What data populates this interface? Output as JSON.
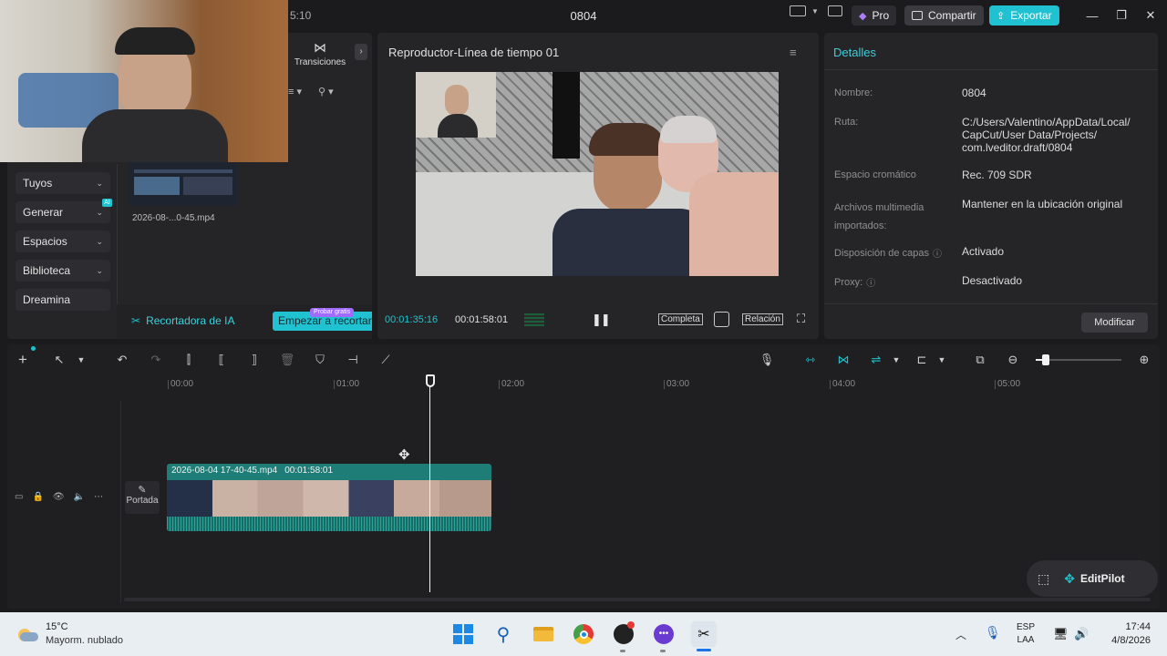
{
  "window": {
    "title": "0804",
    "clock_partial": "5:10",
    "pro_label": "Pro",
    "share_label": "Compartir",
    "export_label": "Exportar"
  },
  "media_panel": {
    "transitions_label": "Transiciones",
    "sidebar": [
      {
        "label": "Tuyos"
      },
      {
        "label": "Generar",
        "badge": "AI"
      },
      {
        "label": "Espacios"
      },
      {
        "label": "Biblioteca"
      },
      {
        "label": "Dreamina"
      }
    ],
    "clip_name": "2026-08-...0-45.mp4",
    "ai_cutter_label": "Recortadora de IA",
    "start_cut_label": "Empezar a recortar",
    "try_free_badge": "Probar gratis"
  },
  "player": {
    "title": "Reproductor-Línea de tiempo 01",
    "current_time": "00:01:35:16",
    "total_time": "00:01:58:01",
    "full_label": "Completa",
    "ratio_label": "Relación"
  },
  "details": {
    "title": "Detalles",
    "rows": [
      {
        "key": "Nombre:",
        "value": "0804"
      },
      {
        "key": "Ruta:",
        "value": "C:/Users/Valentino/AppData/Local/\nCapCut/User Data/Projects/\ncom.lveditor.draft/0804"
      },
      {
        "key": "Espacio cromático",
        "value": "Rec. 709 SDR"
      },
      {
        "key": "Archivos multimedia\nimportados:",
        "value": "Mantener en la ubicación original"
      },
      {
        "key": "Disposición de capas",
        "value": "Activado"
      },
      {
        "key": "Proxy:",
        "value": "Desactivado"
      }
    ],
    "modify_label": "Modificar"
  },
  "timeline": {
    "ticks": [
      "00:00",
      "01:00",
      "02:00",
      "03:00",
      "04:00",
      "05:00"
    ],
    "clip_label": "2026-08-04 17-40-45.mp4",
    "clip_duration": "00:01:58:01",
    "cover_label": "Portada",
    "editpilot_label": "EditPilot"
  },
  "taskbar": {
    "temperature": "15°C",
    "weather": "Mayorm. nublado",
    "lang_top": "ESP",
    "lang_bottom": "LAA",
    "time": "17:44",
    "date": "4/8/2026"
  },
  "colors": {
    "accent": "#1fc3cf",
    "export": "#20c1d0",
    "clip_track": "#1e7d77",
    "pro_purple": "#b07cff"
  }
}
